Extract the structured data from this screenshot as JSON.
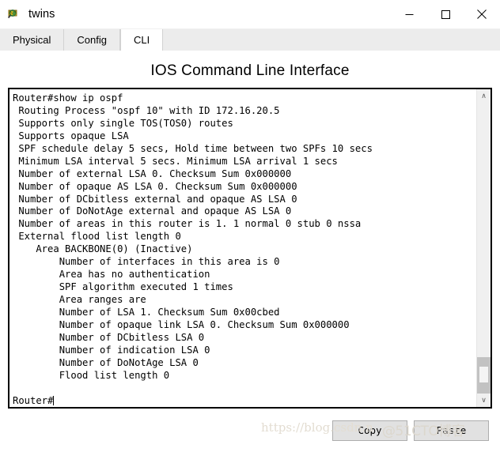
{
  "window": {
    "title": "twins",
    "icon": "packet-tracer-icon",
    "controls": {
      "minimize": "—",
      "maximize": "□",
      "close": "✕"
    }
  },
  "tabs": [
    {
      "label": "Physical",
      "active": false
    },
    {
      "label": "Config",
      "active": false
    },
    {
      "label": "CLI",
      "active": true
    }
  ],
  "header": {
    "title": "IOS Command Line Interface"
  },
  "terminal": {
    "lines": [
      "Router#show ip ospf",
      " Routing Process \"ospf 10\" with ID 172.16.20.5",
      " Supports only single TOS(TOS0) routes",
      " Supports opaque LSA",
      " SPF schedule delay 5 secs, Hold time between two SPFs 10 secs",
      " Minimum LSA interval 5 secs. Minimum LSA arrival 1 secs",
      " Number of external LSA 0. Checksum Sum 0x000000",
      " Number of opaque AS LSA 0. Checksum Sum 0x000000",
      " Number of DCbitless external and opaque AS LSA 0",
      " Number of DoNotAge external and opaque AS LSA 0",
      " Number of areas in this router is 1. 1 normal 0 stub 0 nssa",
      " External flood list length 0",
      "    Area BACKBONE(0) (Inactive)",
      "        Number of interfaces in this area is 0",
      "        Area has no authentication",
      "        SPF algorithm executed 1 times",
      "        Area ranges are",
      "        Number of LSA 1. Checksum Sum 0x00cbed",
      "        Number of opaque link LSA 0. Checksum Sum 0x000000",
      "        Number of DCbitless LSA 0",
      "        Number of indication LSA 0",
      "        Number of DoNotAge LSA 0",
      "        Flood list length 0",
      "",
      "Router#"
    ],
    "prompt": "Router#"
  },
  "scrollbar": {
    "up_arrow": "∧",
    "down_arrow": "∨"
  },
  "footer": {
    "copy_label": "Copy",
    "paste_label": "Paste"
  },
  "watermark": {
    "url": "https://blog.csdn.n",
    "mark": "@51CTO博客"
  }
}
